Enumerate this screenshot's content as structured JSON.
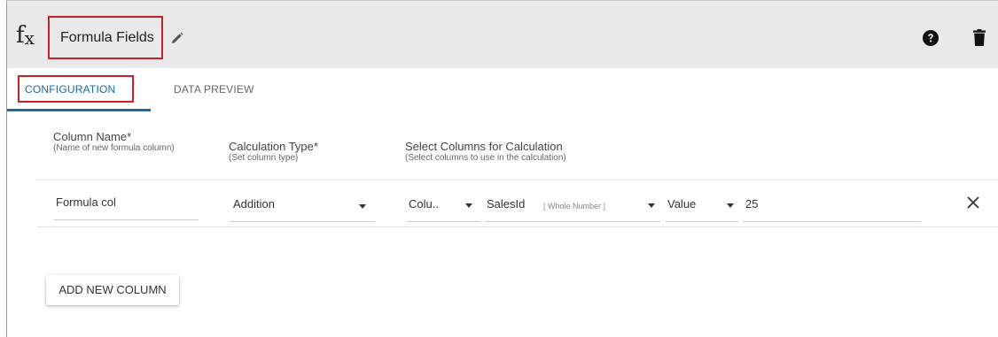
{
  "header": {
    "fx_symbol": "f",
    "fx_sub": "x",
    "title": "Formula Fields"
  },
  "tabs": [
    {
      "label": "CONFIGURATION",
      "active": true
    },
    {
      "label": "DATA PREVIEW",
      "active": false
    }
  ],
  "columns": {
    "column_name": {
      "label": "Column Name*",
      "hint": "(Name of new formula column)"
    },
    "calculation_type": {
      "label": "Calculation Type*",
      "hint": "(Set column type)"
    },
    "select_columns": {
      "label": "Select Columns for Calculation",
      "hint": "(Select columns to use in the calculation)"
    }
  },
  "row": {
    "name": "Formula col",
    "calculation": "Addition",
    "operand_type": "Colu..",
    "column": "SalesId",
    "column_type": "[ Whole Number ]",
    "value_type": "Value",
    "value": "25"
  },
  "add_button": {
    "label": "ADD NEW COLUMN"
  },
  "colors": {
    "accent": "#1c6b9c",
    "highlight_border": "#c0252b",
    "header_bg": "#e9e9e9"
  }
}
